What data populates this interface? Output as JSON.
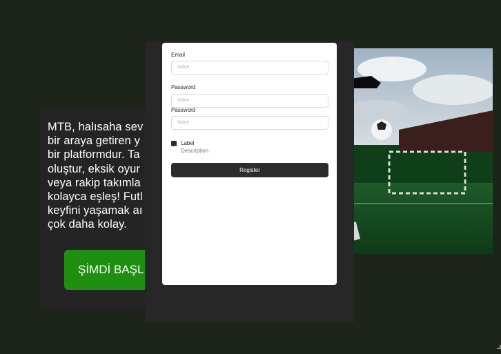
{
  "hero": {
    "text": "MTB, halısaha sev\nbir araya getiren y\nbir platformdur. Ta\noluştur, eksik oyur\nveya rakip takımla\nkolayca eşleş! Futl\nkeyfini yaşamak aı\nçok daha kolay.",
    "cta_label": "ŞİMDİ BAŞL"
  },
  "form": {
    "email_label": "Email",
    "email_placeholder": "Value",
    "password_label": "Password",
    "password_placeholder": "Value",
    "password_confirm_label": "Password",
    "password_confirm_placeholder": "Value",
    "checkbox_label": "Label",
    "checkbox_description": "Description",
    "checkbox_checked": true,
    "register_label": "Register"
  },
  "colors": {
    "page_bg": "#1d251b",
    "card_bg": "#242424",
    "cta_green": "#1f8f12",
    "button_dark": "#2c2c2c"
  }
}
